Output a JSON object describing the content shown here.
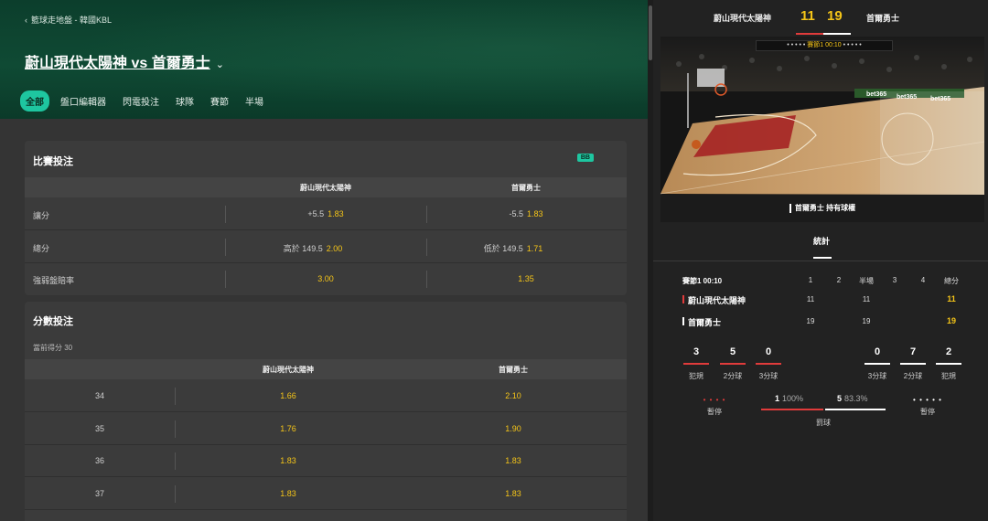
{
  "colors": {
    "accent": "#1ec6a0",
    "odds": "#f5c518",
    "home": "#e03b3b",
    "away": "#ffffff"
  },
  "breadcrumb": {
    "arrow": "‹",
    "text": "籃球走地盤 - 韓國KBL"
  },
  "match": {
    "title": "蔚山現代太陽神 vs 首爾勇士",
    "chevron": "⌄"
  },
  "tabs": [
    "全部",
    "盤口編輯器",
    "閃電投注",
    "球隊",
    "賽節",
    "半場"
  ],
  "game_lines": {
    "title": "比賽投注",
    "badge": "BB",
    "headers": {
      "home": "蔚山現代太陽神",
      "away": "首爾勇士"
    },
    "rows": [
      {
        "label": "讓分",
        "home_line": "+5.5",
        "home_odds": "1.83",
        "away_line": "-5.5",
        "away_odds": "1.83"
      },
      {
        "label": "總分",
        "home_line": "高於 149.5",
        "home_odds": "2.00",
        "away_line": "低於 149.5",
        "away_odds": "1.71"
      },
      {
        "label": "強弱盤賠率",
        "home_line": "",
        "home_odds": "3.00",
        "away_line": "",
        "away_odds": "1.35"
      }
    ]
  },
  "points_bet": {
    "title": "分數投注",
    "current": "當前得分 30",
    "headers": {
      "home": "蔚山現代太陽神",
      "away": "首爾勇士"
    },
    "rows": [
      {
        "points": "34",
        "home": "1.66",
        "away": "2.10"
      },
      {
        "points": "35",
        "home": "1.76",
        "away": "1.90"
      },
      {
        "points": "36",
        "home": "1.83",
        "away": "1.83"
      },
      {
        "points": "37",
        "home": "1.83",
        "away": "1.83"
      }
    ]
  },
  "scoreboard": {
    "home": "蔚山現代太陽神",
    "home_score": "11",
    "away_score": "19",
    "away": "首爾勇士"
  },
  "court": {
    "timer_dots_left": "• • • • •",
    "quarter": "賽節1",
    "clock": "00:10",
    "timer_dots_right": "• • • • •",
    "ads": [
      "bet365",
      "bet365",
      "bet365"
    ]
  },
  "possession": "首爾勇士 持有球權",
  "stats_tab": "統計",
  "boxscore": {
    "period": "賽節1 00:10",
    "columns": [
      "1",
      "2",
      "半場",
      "3",
      "4",
      "總分"
    ],
    "teams": [
      {
        "name": "蔚山現代太陽神",
        "q1": "11",
        "q2": "",
        "half": "11",
        "q3": "",
        "q4": "",
        "total": "11"
      },
      {
        "name": "首爾勇士",
        "q1": "19",
        "q2": "",
        "half": "19",
        "q3": "",
        "q4": "",
        "total": "19"
      }
    ]
  },
  "team_stats": {
    "home": [
      {
        "value": "3",
        "label": "犯規"
      },
      {
        "value": "5",
        "label": "2分球"
      },
      {
        "value": "0",
        "label": "3分球"
      }
    ],
    "away": [
      {
        "value": "0",
        "label": "3分球"
      },
      {
        "value": "7",
        "label": "2分球"
      },
      {
        "value": "2",
        "label": "犯規"
      }
    ]
  },
  "timeouts": {
    "home_dots": "• • • •",
    "home_label": "暫停",
    "away_dots": "• • • • •",
    "away_label": "暫停"
  },
  "free_throws": {
    "home_value": "1",
    "home_pct": "100%",
    "away_value": "5",
    "away_pct": "83.3%",
    "label": "罰球",
    "home_share": 0.5,
    "away_share": 0.5
  }
}
